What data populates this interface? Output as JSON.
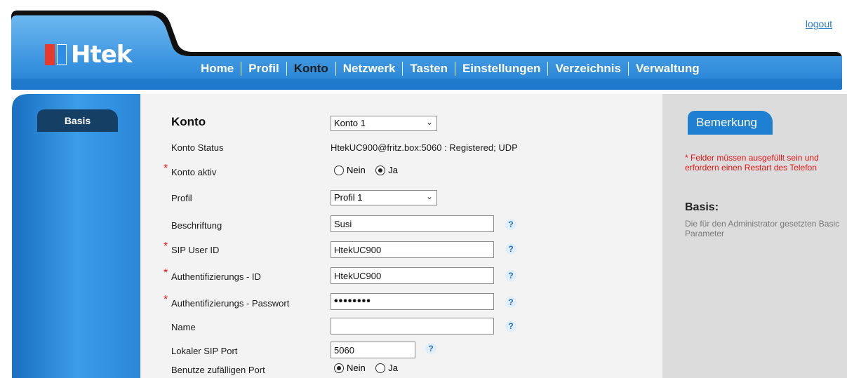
{
  "header": {
    "logout": "logout",
    "logo_text": "Htek",
    "logo_colors": [
      "#e8392f",
      "#2f8de6"
    ],
    "nav": [
      {
        "label": "Home",
        "active": false
      },
      {
        "label": "Profil",
        "active": false
      },
      {
        "label": "Konto",
        "active": true
      },
      {
        "label": "Netzwerk",
        "active": false
      },
      {
        "label": "Tasten",
        "active": false
      },
      {
        "label": "Einstellungen",
        "active": false
      },
      {
        "label": "Verzeichnis",
        "active": false
      },
      {
        "label": "Verwaltung",
        "active": false
      }
    ]
  },
  "sidebar": {
    "tab": "Basis"
  },
  "form": {
    "title": "Konto",
    "konto_select": "Konto 1",
    "status_label": "Konto Status",
    "status_value": "HtekUC900@fritz.box:5060 : Registered; UDP",
    "aktiv_label": "Konto aktiv",
    "aktiv_options": [
      "Nein",
      "Ja"
    ],
    "aktiv_selected": "Ja",
    "profil_label": "Profil",
    "profil_select": "Profil 1",
    "beschriftung_label": "Beschriftung",
    "beschriftung_value": "Susi",
    "sip_user_label": "SIP User ID",
    "sip_user_value": "HtekUC900",
    "auth_id_label": "Authentifizierungs - ID",
    "auth_id_value": "HtekUC900",
    "auth_pw_label": "Authentifizierungs - Passwort",
    "auth_pw_value": "••••••••",
    "name_label": "Name",
    "name_value": "",
    "port_label": "Lokaler SIP Port",
    "port_value": "5060",
    "random_label": "Benutze zufälligen Port",
    "random_options": [
      "Nein",
      "Ja"
    ],
    "random_selected": "Nein",
    "required_mark": "*",
    "help_icon": "?"
  },
  "notes": {
    "tab": "Bemerkung",
    "required_note": "* Felder müssen ausgefüllt sein und erfordern einen Restart des Telefon",
    "basis_title": "Basis:",
    "basis_text": "Die für den Administrator gesetzten Basic Parameter"
  },
  "colors": {
    "header_blue": "#2b8de0",
    "header_dark": "#0f0f0f",
    "sidebar_blue": "#2a8ae0",
    "tab_dark": "#163f66",
    "accent_red": "#e31515"
  }
}
